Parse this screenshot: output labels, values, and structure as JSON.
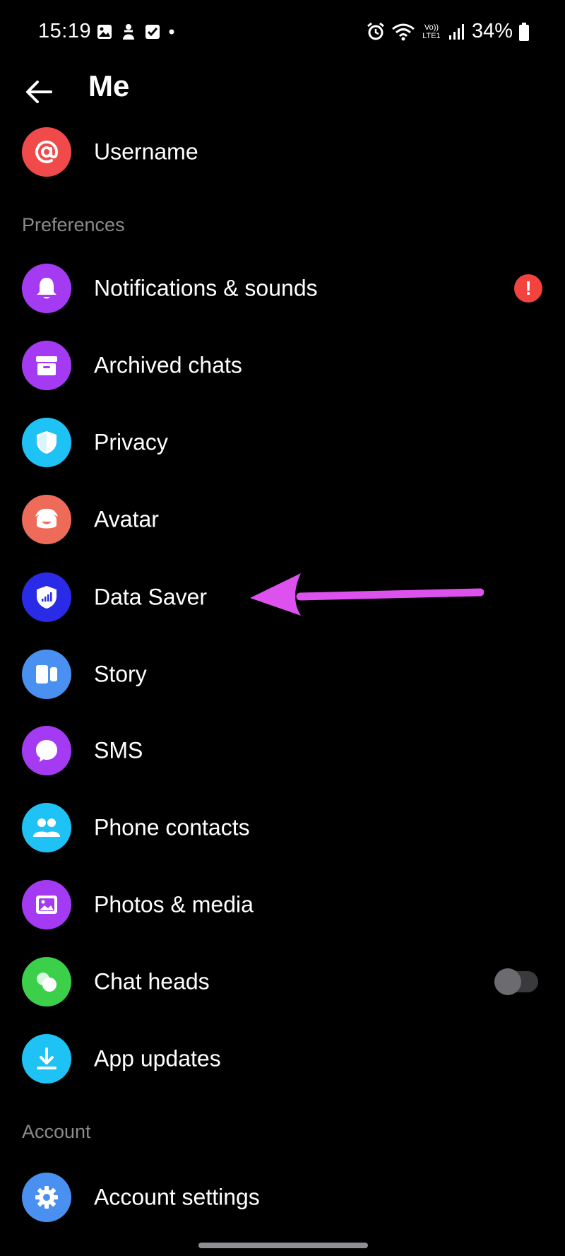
{
  "status_bar": {
    "time": "15:19",
    "battery": "34%",
    "network_label": "Vo)) LTE1"
  },
  "header": {
    "title": "Me"
  },
  "top_items": [
    {
      "label": "Username",
      "icon": "at-sign-icon",
      "color": "#f04a4a"
    }
  ],
  "sections": {
    "preferences": "Preferences",
    "account": "Account"
  },
  "preferences_items": [
    {
      "label": "Notifications & sounds",
      "icon": "bell-icon",
      "color": "#a43bf2",
      "badge": "!"
    },
    {
      "label": "Archived chats",
      "icon": "archive-icon",
      "color": "#a43bf2"
    },
    {
      "label": "Privacy",
      "icon": "shield-icon",
      "color": "#1ec2f5"
    },
    {
      "label": "Avatar",
      "icon": "avatar-face-icon",
      "color": "#ee6b59"
    },
    {
      "label": "Data Saver",
      "icon": "data-shield-icon",
      "color": "#2a2be6"
    },
    {
      "label": "Story",
      "icon": "story-icon",
      "color": "#4a90f0"
    },
    {
      "label": "SMS",
      "icon": "chat-bubble-icon",
      "color": "#a43bf2"
    },
    {
      "label": "Phone contacts",
      "icon": "people-icon",
      "color": "#1ec2f5"
    },
    {
      "label": "Photos & media",
      "icon": "photo-icon",
      "color": "#a43bf2"
    },
    {
      "label": "Chat heads",
      "icon": "chat-heads-icon",
      "color": "#3ccf4a",
      "toggle": false
    },
    {
      "label": "App updates",
      "icon": "download-icon",
      "color": "#1ec2f5"
    }
  ],
  "account_items": [
    {
      "label": "Account settings",
      "icon": "gear-icon",
      "color": "#4a90f0"
    }
  ],
  "annotation": {
    "arrow_color": "#dd52ee"
  }
}
